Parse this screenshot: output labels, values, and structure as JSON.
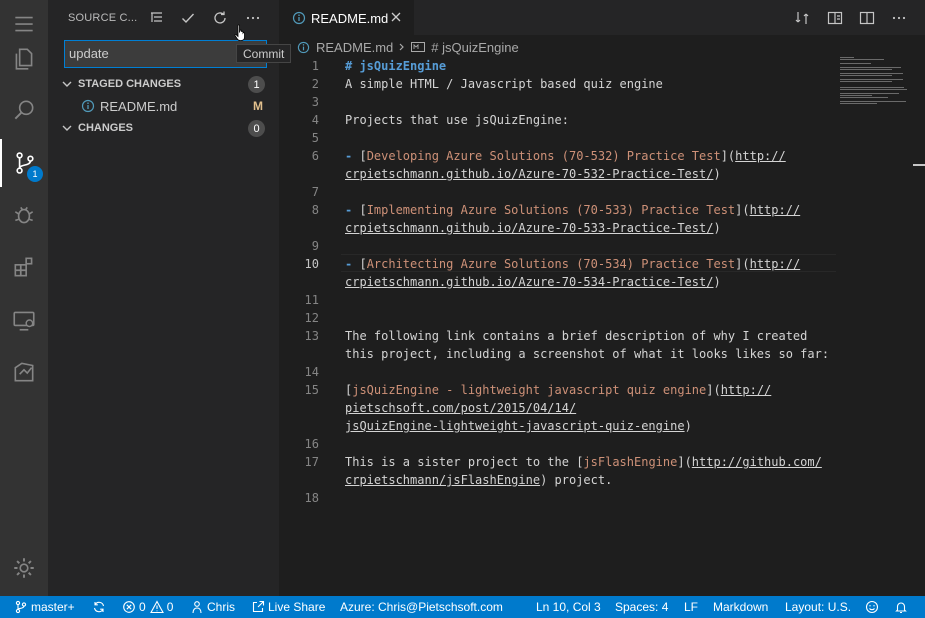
{
  "sidebar": {
    "title": "SOURCE C...",
    "commit_message": "update",
    "tooltip": "Commit",
    "staged": {
      "label": "STAGED CHANGES",
      "count": "1"
    },
    "staged_file": {
      "name": "README.md",
      "status": "M"
    },
    "changes": {
      "label": "CHANGES",
      "count": "0"
    }
  },
  "activity": {
    "scm_badge": "1"
  },
  "editor": {
    "tab": {
      "label": "README.md"
    },
    "breadcrumb": {
      "file": "README.md",
      "symbol": "# jsQuizEngine"
    },
    "lines": [
      {
        "n": "1",
        "segs": [
          {
            "c": "h1",
            "t": "# jsQuizEngine"
          }
        ]
      },
      {
        "n": "2",
        "segs": [
          {
            "c": "pl",
            "t": "A simple HTML / Javascript based quiz engine"
          }
        ]
      },
      {
        "n": "3",
        "segs": []
      },
      {
        "n": "4",
        "segs": [
          {
            "c": "pl",
            "t": "Projects that use jsQuizEngine:"
          }
        ]
      },
      {
        "n": "5",
        "segs": []
      },
      {
        "n": "6",
        "segs": [
          {
            "c": "h1",
            "t": "-"
          },
          {
            "c": "pl",
            "t": " ["
          },
          {
            "c": "lt",
            "t": "Developing Azure Solutions (70-532) Practice Test"
          },
          {
            "c": "pl",
            "t": "]("
          },
          {
            "c": "lu",
            "t": "http://"
          }
        ]
      },
      {
        "n": "",
        "segs": [
          {
            "c": "lu",
            "t": "crpietschmann.github.io/Azure-70-532-Practice-Test/"
          },
          {
            "c": "pl",
            "t": ")"
          }
        ]
      },
      {
        "n": "7",
        "segs": []
      },
      {
        "n": "8",
        "segs": [
          {
            "c": "h1",
            "t": "-"
          },
          {
            "c": "pl",
            "t": " ["
          },
          {
            "c": "lt",
            "t": "Implementing Azure Solutions (70-533) Practice Test"
          },
          {
            "c": "pl",
            "t": "]("
          },
          {
            "c": "lu",
            "t": "http://"
          }
        ]
      },
      {
        "n": "",
        "segs": [
          {
            "c": "lu",
            "t": "crpietschmann.github.io/Azure-70-533-Practice-Test/"
          },
          {
            "c": "pl",
            "t": ")"
          }
        ]
      },
      {
        "n": "9",
        "segs": []
      },
      {
        "n": "10",
        "segs": [
          {
            "c": "h1",
            "t": "-"
          },
          {
            "c": "pl",
            "t": " ["
          },
          {
            "c": "lt",
            "t": "Architecting Azure Solutions (70-534) Practice Test"
          },
          {
            "c": "pl",
            "t": "]("
          },
          {
            "c": "lu",
            "t": "http://"
          }
        ]
      },
      {
        "n": "",
        "segs": [
          {
            "c": "lu",
            "t": "crpietschmann.github.io/Azure-70-534-Practice-Test/"
          },
          {
            "c": "pl",
            "t": ")"
          }
        ]
      },
      {
        "n": "11",
        "segs": []
      },
      {
        "n": "12",
        "segs": []
      },
      {
        "n": "13",
        "segs": [
          {
            "c": "pl",
            "t": "The following link contains a brief description of why I created"
          }
        ]
      },
      {
        "n": "",
        "segs": [
          {
            "c": "pl",
            "t": "this project, including a screenshot of what it looks likes so far:"
          }
        ]
      },
      {
        "n": "14",
        "segs": []
      },
      {
        "n": "15",
        "segs": [
          {
            "c": "pl",
            "t": "["
          },
          {
            "c": "lt",
            "t": "jsQuizEngine - lightweight javascript quiz engine"
          },
          {
            "c": "pl",
            "t": "]("
          },
          {
            "c": "lu",
            "t": "http://"
          }
        ]
      },
      {
        "n": "",
        "segs": [
          {
            "c": "lu",
            "t": "pietschsoft.com/post/2015/04/14/"
          }
        ]
      },
      {
        "n": "",
        "segs": [
          {
            "c": "lu",
            "t": "jsQuizEngine-lightweight-javascript-quiz-engine"
          },
          {
            "c": "pl",
            "t": ")"
          }
        ]
      },
      {
        "n": "16",
        "segs": []
      },
      {
        "n": "17",
        "segs": [
          {
            "c": "pl",
            "t": "This is a sister project to the ["
          },
          {
            "c": "lt",
            "t": "jsFlashEngine"
          },
          {
            "c": "pl",
            "t": "]("
          },
          {
            "c": "lu",
            "t": "http://github.com/"
          }
        ]
      },
      {
        "n": "",
        "segs": [
          {
            "c": "lu",
            "t": "crpietschmann/jsFlashEngine"
          },
          {
            "c": "pl",
            "t": ") project."
          }
        ]
      },
      {
        "n": "18",
        "segs": []
      }
    ]
  },
  "status": {
    "branch": "master+",
    "errors": "0",
    "warnings": "0",
    "user": "Chris",
    "live_share": "Live Share",
    "azure": "Azure: Chris@Pietschsoft.com",
    "position": "Ln 10, Col 3",
    "spaces": "Spaces: 4",
    "eol": "LF",
    "language": "Markdown",
    "layout": "Layout: U.S."
  },
  "colors": {
    "accent": "#007acc",
    "modified": "#e2c08d",
    "heading": "#569cd6",
    "link_text": "#ce9178"
  }
}
